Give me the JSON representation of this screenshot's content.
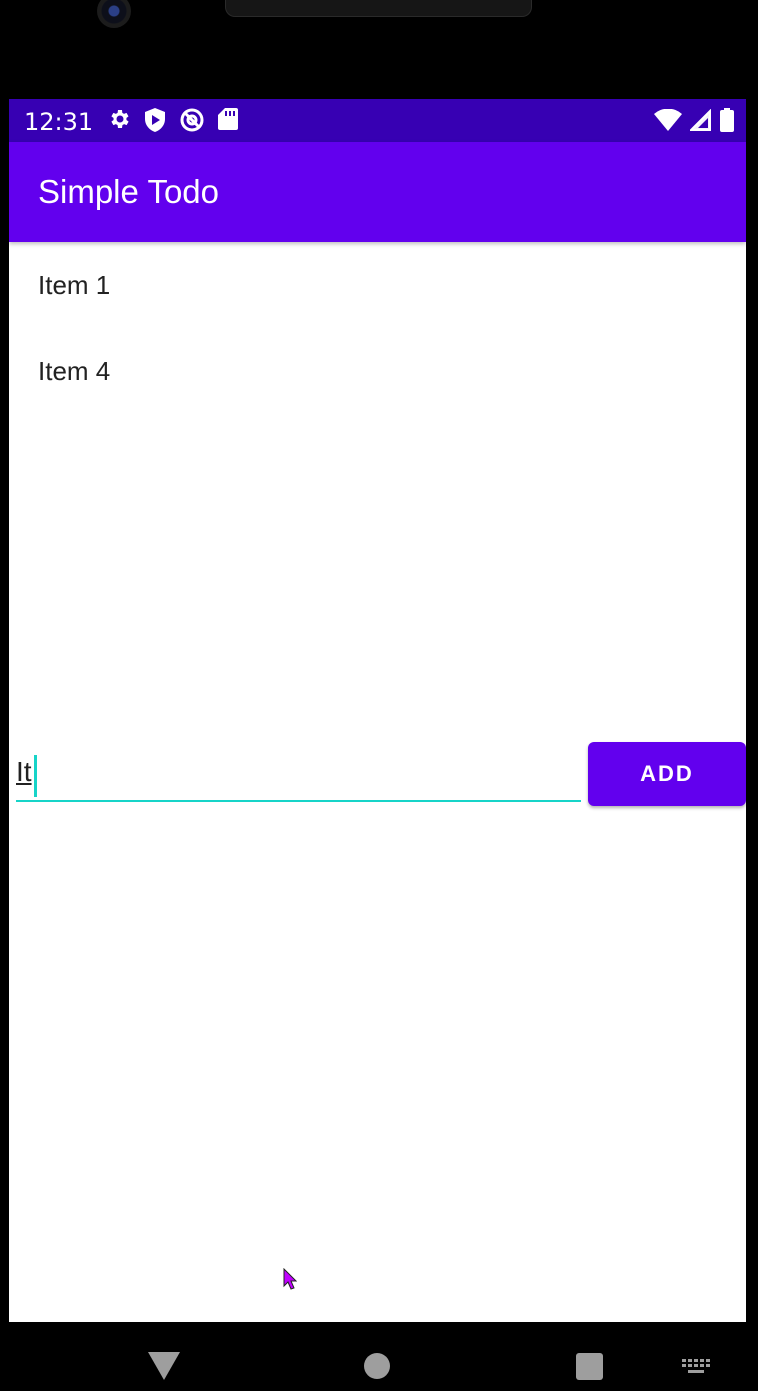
{
  "status_bar": {
    "time": "12:31",
    "left_icons": [
      "settings-icon",
      "shield-play-icon",
      "no-tracking-icon",
      "sd-card-icon"
    ],
    "right_icons": [
      "wifi-icon",
      "cell-signal-icon",
      "battery-icon"
    ],
    "color": "#3700b3"
  },
  "app_bar": {
    "title": "Simple Todo",
    "color": "#6200ee"
  },
  "todo_list": {
    "items": [
      {
        "label": "Item 1"
      },
      {
        "label": "Item 4"
      }
    ]
  },
  "input": {
    "value": "It",
    "accent_color": "#17d4c8"
  },
  "add_button": {
    "label": "ADD"
  },
  "nav_bar": {
    "icons": [
      "back-icon",
      "home-icon",
      "recents-icon",
      "keyboard-icon"
    ]
  }
}
